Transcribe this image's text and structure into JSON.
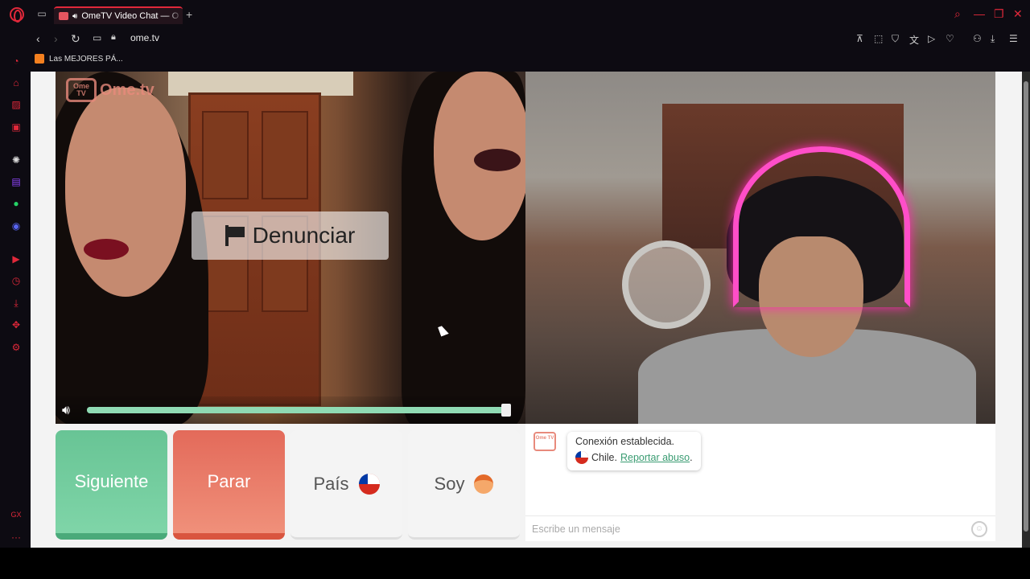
{
  "browser": {
    "tab": {
      "title": "OmeTV Video Chat — O"
    },
    "url": "ome.tv",
    "bookmark": {
      "label": "Las MEJORES PÁ..."
    },
    "icons": {
      "logo": "opera-gx-icon",
      "tabs": "tab-list-icon",
      "new_tab": "+",
      "back": "‹",
      "forward": "›",
      "reload": "↻",
      "camera": "camera-icon",
      "lock": "lock-icon"
    },
    "sidebar_label": "GX",
    "sidebar_more": "···",
    "accent_color": "#e0283a"
  },
  "site": {
    "brand": "Ome.tv",
    "brand_icon_text": "Ome TV",
    "report_button": "Denunciar",
    "volume": {
      "level": 1.0
    },
    "controls": {
      "next": "Siguiente",
      "stop": "Parar",
      "country": "País",
      "gender": "Soy"
    },
    "chat": {
      "status": "Conexión establecida.",
      "country": "Chile.",
      "report_link": "Reportar abuso",
      "report_suffix": ".",
      "input_placeholder": "Escribe un mensaje"
    },
    "colors": {
      "next": "#68c495",
      "stop": "#e36a5a",
      "link": "#3a9c72"
    }
  }
}
